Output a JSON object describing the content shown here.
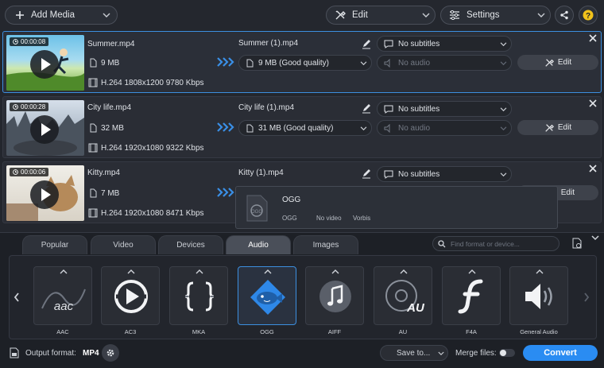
{
  "toolbar": {
    "add_media": "Add Media",
    "edit": "Edit",
    "settings": "Settings"
  },
  "files": [
    {
      "duration": "00:00:08",
      "name": "Summer.mp4",
      "size": "9 MB",
      "codec": "H.264 1808x1200 9780 Kbps",
      "output_name": "Summer (1).mp4",
      "output_size": "9 MB (Good quality)",
      "subtitles": "No subtitles",
      "audio": "No audio",
      "edit_label": "Edit"
    },
    {
      "duration": "00:00:28",
      "name": "City life.mp4",
      "size": "32 MB",
      "codec": "H.264 1920x1080 9322 Kbps",
      "output_name": "City life (1).mp4",
      "output_size": "31 MB (Good quality)",
      "subtitles": "No subtitles",
      "audio": "No audio",
      "edit_label": "Edit"
    },
    {
      "duration": "00:00:06",
      "name": "Kitty.mp4",
      "size": "7 MB",
      "codec": "H.264 1920x1080 8471 Kbps",
      "output_name": "Kitty (1).mp4",
      "subtitles": "No subtitles",
      "edit_label": "Edit"
    }
  ],
  "popup": {
    "title": "OGG",
    "col1": "OGG",
    "col2": "No video",
    "col3": "Vorbis"
  },
  "tabs": [
    "Popular",
    "Video",
    "Devices",
    "Audio",
    "Images"
  ],
  "active_tab": "Audio",
  "search_placeholder": "Find format or device...",
  "formats": [
    {
      "label": "AAC",
      "icon": "aac-icon"
    },
    {
      "label": "AC3",
      "icon": "ac3-icon"
    },
    {
      "label": "MKA",
      "icon": "mka-icon"
    },
    {
      "label": "OGG",
      "icon": "ogg-icon"
    },
    {
      "label": "AIFF",
      "icon": "aiff-icon"
    },
    {
      "label": "AU",
      "icon": "au-icon"
    },
    {
      "label": "F4A",
      "icon": "f4a-icon"
    },
    {
      "label": "General Audio",
      "icon": "general-audio-icon"
    }
  ],
  "formats_icon_text": {
    "aac": "aac",
    "au": "AU"
  },
  "footer": {
    "output_format_label": "Output format:",
    "output_format_value": "MP4",
    "save_to": "Save to...",
    "merge_files": "Merge files:",
    "convert": "Convert"
  },
  "colors": {
    "accent": "#2a8cf2",
    "selection": "#3c8fe0"
  }
}
